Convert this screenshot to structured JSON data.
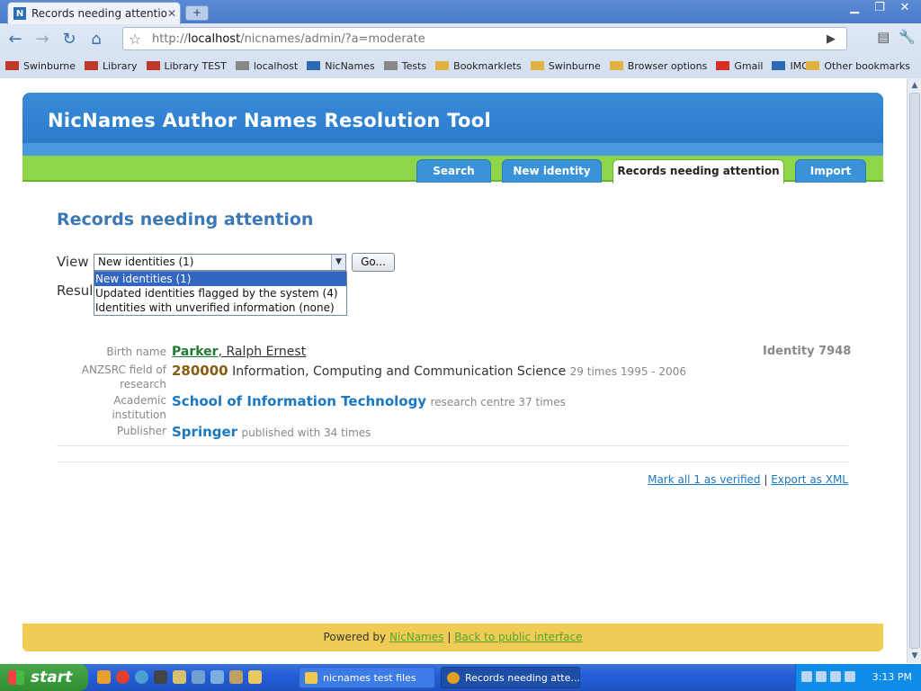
{
  "browser": {
    "tab_title": "Records needing attention ...",
    "tab_favicon": "N",
    "url_scheme_prefix": "http://",
    "url_host": "localhost",
    "url_path": "/nicnames/admin/?a=moderate",
    "bookmarks": [
      {
        "label": "Swinburne",
        "icon": "swinburne-logo-icon",
        "color": "#c0392b"
      },
      {
        "label": "Library",
        "icon": "swinburne-logo-icon",
        "color": "#c0392b"
      },
      {
        "label": "Library TEST",
        "icon": "swinburne-logo-icon",
        "color": "#c0392b"
      },
      {
        "label": "localhost",
        "icon": "page-icon",
        "color": "#888888"
      },
      {
        "label": "NicNames",
        "icon": "nicnames-icon",
        "color": "#2d6bb6"
      },
      {
        "label": "Tests",
        "icon": "page-icon",
        "color": "#888888"
      },
      {
        "label": "Bookmarklets",
        "icon": "folder-icon",
        "color": "#e0b040"
      },
      {
        "label": "Swinburne",
        "icon": "folder-icon",
        "color": "#e0b040"
      },
      {
        "label": "Browser options",
        "icon": "folder-icon",
        "color": "#e0b040"
      },
      {
        "label": "Gmail",
        "icon": "gmail-icon",
        "color": "#d93025"
      },
      {
        "label": "IMO",
        "icon": "imo-icon",
        "color": "#2d6bb6"
      }
    ],
    "other_bookmarks": "Other bookmarks"
  },
  "site": {
    "title": "NicNames Author Names Resolution Tool",
    "nav": [
      {
        "label": "Search",
        "active": false
      },
      {
        "label": "New identity",
        "active": false
      },
      {
        "label": "Records needing attention",
        "active": true
      },
      {
        "label": "Import",
        "active": false
      }
    ]
  },
  "main": {
    "heading": "Records needing attention",
    "view_label": "View",
    "select_value": "New identities (1)",
    "go_button": "Go...",
    "results_label": "Results",
    "dropdown_options": [
      {
        "label": "New identities (1)",
        "selected": true
      },
      {
        "label": "Updated identities flagged by the system (4)",
        "selected": false
      },
      {
        "label": "Identities with unverified information (none)",
        "selected": false
      }
    ],
    "record": {
      "identity": "Identity 7948",
      "birth_name_label": "Birth name",
      "surname": "Parker",
      "given_names": ", Ralph Ernest",
      "field_label": "ANZSRC field of research",
      "field_code": "280000",
      "field_name": "Information, Computing and Communication Science",
      "field_stats": "29 times 1995 - 2006",
      "institution_label": "Academic institution",
      "institution": "School of Information Technology",
      "institution_stats": "research centre 37 times",
      "publisher_label": "Publisher",
      "publisher": "Springer",
      "publisher_stats": "published with 34 times"
    },
    "mark_verified": "Mark all 1 as verified",
    "separator": "|",
    "export_xml": "Export as XML"
  },
  "footer": {
    "powered_by": "Powered by",
    "nicnames_link": "NicNames",
    "separator": "|",
    "public_link": "Back to public interface"
  },
  "taskbar": {
    "start": "start",
    "tasks": [
      {
        "label": "nicnames test files",
        "icon": "folder-icon"
      },
      {
        "label": "Records needing atte...",
        "icon": "chrome-icon"
      }
    ],
    "clock": "3:13 PM"
  }
}
